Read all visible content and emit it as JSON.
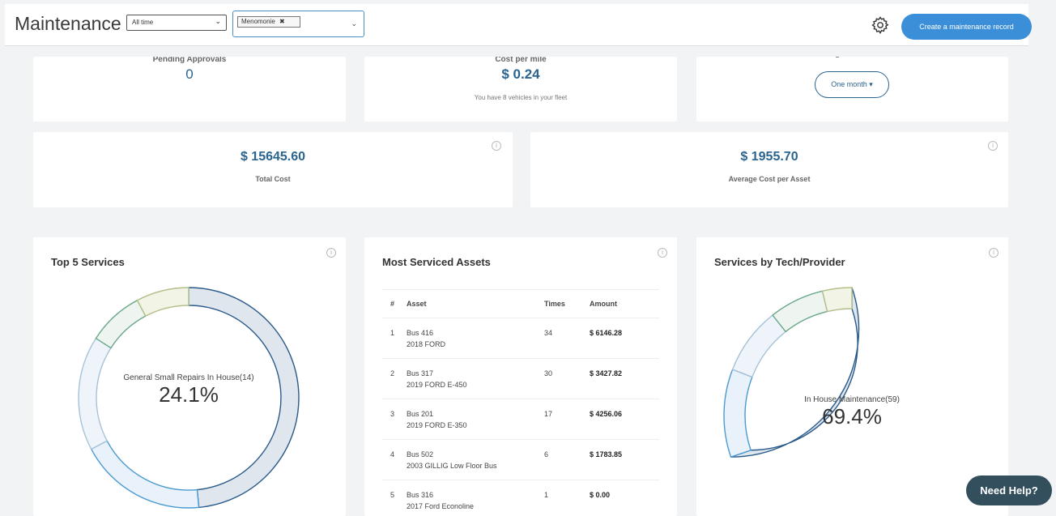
{
  "header": {
    "title": "Maintenance",
    "time_filter": "All time",
    "location_chip": "Menomonie",
    "chip_close": "✖",
    "chevron": "⌄",
    "create_button": "Create a maintenance record",
    "settings_icon": "gear-icon"
  },
  "stats_top": {
    "pending": {
      "label": "Pending Approvals",
      "value": "0"
    },
    "cost_per_mile": {
      "label": "Cost per mile",
      "value": "$ 0.24",
      "sub": "You have 8 vehicles in your fleet"
    },
    "range_button": "One month ▾"
  },
  "stats_mid": {
    "total": {
      "value": "$ 15645.60",
      "label": "Total Cost"
    },
    "average": {
      "value": "$ 1955.70",
      "label": "Average Cost per Asset"
    }
  },
  "info_glyph": "i",
  "top_services": {
    "title": "Top 5 Services",
    "center_label": "General Small Repairs In House(14)",
    "center_pct": "24.1%"
  },
  "most_serviced": {
    "title": "Most Serviced Assets",
    "columns": [
      "#",
      "Asset",
      "Times",
      "Amount"
    ],
    "rows": [
      {
        "n": "1",
        "asset": "Bus 416",
        "desc": "2018 FORD",
        "times": "34",
        "amount": "$ 6146.28"
      },
      {
        "n": "2",
        "asset": "Bus 317",
        "desc": "2019 FORD E-450",
        "times": "30",
        "amount": "$ 3427.82"
      },
      {
        "n": "3",
        "asset": "Bus 201",
        "desc": "2019 FORD E-350",
        "times": "17",
        "amount": "$ 4256.06"
      },
      {
        "n": "4",
        "asset": "Bus 502",
        "desc": "2003 GILLIG Low Floor Bus",
        "times": "6",
        "amount": "$ 1783.85"
      },
      {
        "n": "5",
        "asset": "Bus 316",
        "desc": "2017 Ford Econoline",
        "times": "1",
        "amount": "$ 0.00"
      }
    ]
  },
  "services_by_tech": {
    "title": "Services by Tech/Provider",
    "center_label": "In House Maintenance(59)",
    "center_pct": "69.4%"
  },
  "help_button": "Need Help?",
  "colors": {
    "accent": "#3a8fd8",
    "value_blue": "#2a648f",
    "help_bg": "#334e5c"
  }
}
